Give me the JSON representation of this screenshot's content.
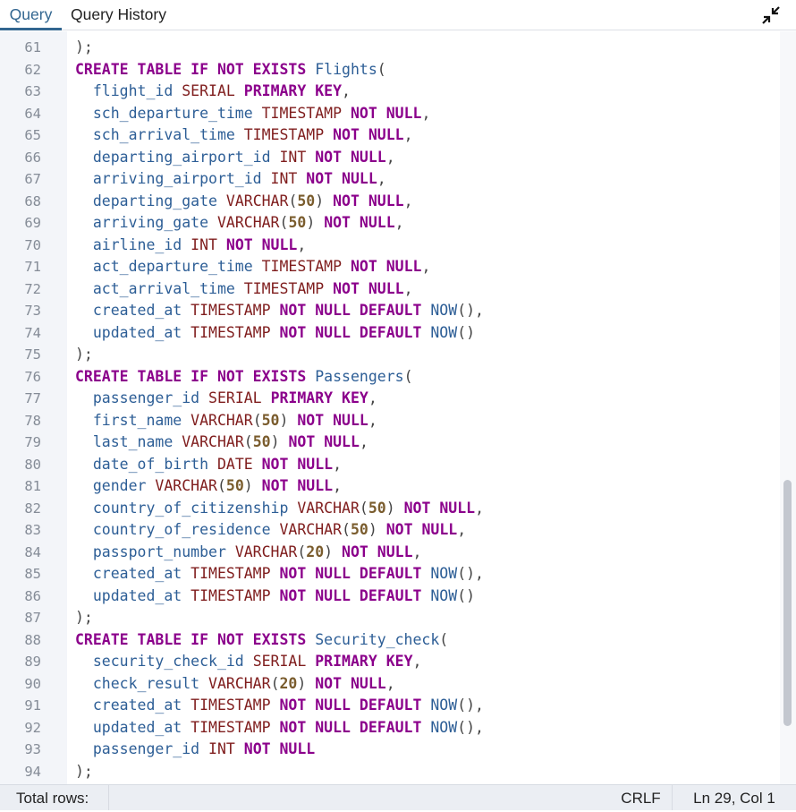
{
  "tabs": [
    {
      "label": "Query",
      "active": true
    },
    {
      "label": "Query History",
      "active": false
    }
  ],
  "icons": {
    "collapse": "collapse-arrows-icon"
  },
  "colors": {
    "accent": "#326690",
    "keyword": "#8b008b",
    "type": "#7f1d1d",
    "identifier": "#2d5e96",
    "number": "#7a5c2d"
  },
  "editor": {
    "lines": [
      {
        "n": "61",
        "tokens": [
          [
            "pu",
            ");"
          ]
        ]
      },
      {
        "n": "62",
        "tokens": [
          [
            "kw",
            "CREATE TABLE IF NOT EXISTS "
          ],
          [
            "id",
            "Flights"
          ],
          [
            "pu",
            "("
          ]
        ]
      },
      {
        "n": "63",
        "tokens": [
          [
            "id",
            "  flight_id "
          ],
          [
            "ty",
            "SERIAL "
          ],
          [
            "kw",
            "PRIMARY KEY"
          ],
          [
            "pu",
            ","
          ]
        ]
      },
      {
        "n": "64",
        "tokens": [
          [
            "id",
            "  sch_departure_time "
          ],
          [
            "ty",
            "TIMESTAMP "
          ],
          [
            "kw",
            "NOT NULL"
          ],
          [
            "pu",
            ","
          ]
        ]
      },
      {
        "n": "65",
        "tokens": [
          [
            "id",
            "  sch_arrival_time "
          ],
          [
            "ty",
            "TIMESTAMP "
          ],
          [
            "kw",
            "NOT NULL"
          ],
          [
            "pu",
            ","
          ]
        ]
      },
      {
        "n": "66",
        "tokens": [
          [
            "id",
            "  departing_airport_id "
          ],
          [
            "ty",
            "INT "
          ],
          [
            "kw",
            "NOT NULL"
          ],
          [
            "pu",
            ","
          ]
        ]
      },
      {
        "n": "67",
        "tokens": [
          [
            "id",
            "  arriving_airport_id "
          ],
          [
            "ty",
            "INT "
          ],
          [
            "kw",
            "NOT NULL"
          ],
          [
            "pu",
            ","
          ]
        ]
      },
      {
        "n": "68",
        "tokens": [
          [
            "id",
            "  departing_gate "
          ],
          [
            "ty",
            "VARCHAR"
          ],
          [
            "pu",
            "("
          ],
          [
            "nm",
            "50"
          ],
          [
            "pu",
            ") "
          ],
          [
            "kw",
            "NOT NULL"
          ],
          [
            "pu",
            ","
          ]
        ]
      },
      {
        "n": "69",
        "tokens": [
          [
            "id",
            "  arriving_gate "
          ],
          [
            "ty",
            "VARCHAR"
          ],
          [
            "pu",
            "("
          ],
          [
            "nm",
            "50"
          ],
          [
            "pu",
            ") "
          ],
          [
            "kw",
            "NOT NULL"
          ],
          [
            "pu",
            ","
          ]
        ]
      },
      {
        "n": "70",
        "tokens": [
          [
            "id",
            "  airline_id "
          ],
          [
            "ty",
            "INT "
          ],
          [
            "kw",
            "NOT NULL"
          ],
          [
            "pu",
            ","
          ]
        ]
      },
      {
        "n": "71",
        "tokens": [
          [
            "id",
            "  act_departure_time "
          ],
          [
            "ty",
            "TIMESTAMP "
          ],
          [
            "kw",
            "NOT NULL"
          ],
          [
            "pu",
            ","
          ]
        ]
      },
      {
        "n": "72",
        "tokens": [
          [
            "id",
            "  act_arrival_time "
          ],
          [
            "ty",
            "TIMESTAMP "
          ],
          [
            "kw",
            "NOT NULL"
          ],
          [
            "pu",
            ","
          ]
        ]
      },
      {
        "n": "73",
        "tokens": [
          [
            "id",
            "  created_at "
          ],
          [
            "ty",
            "TIMESTAMP "
          ],
          [
            "kw",
            "NOT NULL DEFAULT "
          ],
          [
            "id",
            "NOW"
          ],
          [
            "pu",
            "(),"
          ]
        ]
      },
      {
        "n": "74",
        "tokens": [
          [
            "id",
            "  updated_at "
          ],
          [
            "ty",
            "TIMESTAMP "
          ],
          [
            "kw",
            "NOT NULL DEFAULT "
          ],
          [
            "id",
            "NOW"
          ],
          [
            "pu",
            "()"
          ]
        ]
      },
      {
        "n": "75",
        "tokens": [
          [
            "pu",
            ");"
          ]
        ]
      },
      {
        "n": "76",
        "tokens": [
          [
            "kw",
            "CREATE TABLE IF NOT EXISTS "
          ],
          [
            "id",
            "Passengers"
          ],
          [
            "pu",
            "("
          ]
        ]
      },
      {
        "n": "77",
        "tokens": [
          [
            "id",
            "  passenger_id "
          ],
          [
            "ty",
            "SERIAL "
          ],
          [
            "kw",
            "PRIMARY KEY"
          ],
          [
            "pu",
            ","
          ]
        ]
      },
      {
        "n": "78",
        "tokens": [
          [
            "id",
            "  first_name "
          ],
          [
            "ty",
            "VARCHAR"
          ],
          [
            "pu",
            "("
          ],
          [
            "nm",
            "50"
          ],
          [
            "pu",
            ") "
          ],
          [
            "kw",
            "NOT NULL"
          ],
          [
            "pu",
            ","
          ]
        ]
      },
      {
        "n": "79",
        "tokens": [
          [
            "id",
            "  last_name "
          ],
          [
            "ty",
            "VARCHAR"
          ],
          [
            "pu",
            "("
          ],
          [
            "nm",
            "50"
          ],
          [
            "pu",
            ") "
          ],
          [
            "kw",
            "NOT NULL"
          ],
          [
            "pu",
            ","
          ]
        ]
      },
      {
        "n": "80",
        "tokens": [
          [
            "id",
            "  date_of_birth "
          ],
          [
            "ty",
            "DATE "
          ],
          [
            "kw",
            "NOT NULL"
          ],
          [
            "pu",
            ","
          ]
        ]
      },
      {
        "n": "81",
        "tokens": [
          [
            "id",
            "  gender "
          ],
          [
            "ty",
            "VARCHAR"
          ],
          [
            "pu",
            "("
          ],
          [
            "nm",
            "50"
          ],
          [
            "pu",
            ") "
          ],
          [
            "kw",
            "NOT NULL"
          ],
          [
            "pu",
            ","
          ]
        ]
      },
      {
        "n": "82",
        "tokens": [
          [
            "id",
            "  country_of_citizenship "
          ],
          [
            "ty",
            "VARCHAR"
          ],
          [
            "pu",
            "("
          ],
          [
            "nm",
            "50"
          ],
          [
            "pu",
            ") "
          ],
          [
            "kw",
            "NOT NULL"
          ],
          [
            "pu",
            ","
          ]
        ]
      },
      {
        "n": "83",
        "tokens": [
          [
            "id",
            "  country_of_residence "
          ],
          [
            "ty",
            "VARCHAR"
          ],
          [
            "pu",
            "("
          ],
          [
            "nm",
            "50"
          ],
          [
            "pu",
            ") "
          ],
          [
            "kw",
            "NOT NULL"
          ],
          [
            "pu",
            ","
          ]
        ]
      },
      {
        "n": "84",
        "tokens": [
          [
            "id",
            "  passport_number "
          ],
          [
            "ty",
            "VARCHAR"
          ],
          [
            "pu",
            "("
          ],
          [
            "nm",
            "20"
          ],
          [
            "pu",
            ") "
          ],
          [
            "kw",
            "NOT NULL"
          ],
          [
            "pu",
            ","
          ]
        ]
      },
      {
        "n": "85",
        "tokens": [
          [
            "id",
            "  created_at "
          ],
          [
            "ty",
            "TIMESTAMP "
          ],
          [
            "kw",
            "NOT NULL DEFAULT "
          ],
          [
            "id",
            "NOW"
          ],
          [
            "pu",
            "(),"
          ]
        ]
      },
      {
        "n": "86",
        "tokens": [
          [
            "id",
            "  updated_at "
          ],
          [
            "ty",
            "TIMESTAMP "
          ],
          [
            "kw",
            "NOT NULL DEFAULT "
          ],
          [
            "id",
            "NOW"
          ],
          [
            "pu",
            "()"
          ]
        ]
      },
      {
        "n": "87",
        "tokens": [
          [
            "pu",
            ");"
          ]
        ]
      },
      {
        "n": "88",
        "tokens": [
          [
            "kw",
            "CREATE TABLE IF NOT EXISTS "
          ],
          [
            "id",
            "Security_check"
          ],
          [
            "pu",
            "("
          ]
        ]
      },
      {
        "n": "89",
        "tokens": [
          [
            "id",
            "  security_check_id "
          ],
          [
            "ty",
            "SERIAL "
          ],
          [
            "kw",
            "PRIMARY KEY"
          ],
          [
            "pu",
            ","
          ]
        ]
      },
      {
        "n": "90",
        "tokens": [
          [
            "id",
            "  check_result "
          ],
          [
            "ty",
            "VARCHAR"
          ],
          [
            "pu",
            "("
          ],
          [
            "nm",
            "20"
          ],
          [
            "pu",
            ") "
          ],
          [
            "kw",
            "NOT NULL"
          ],
          [
            "pu",
            ","
          ]
        ]
      },
      {
        "n": "91",
        "tokens": [
          [
            "id",
            "  created_at "
          ],
          [
            "ty",
            "TIMESTAMP "
          ],
          [
            "kw",
            "NOT NULL DEFAULT "
          ],
          [
            "id",
            "NOW"
          ],
          [
            "pu",
            "(),"
          ]
        ]
      },
      {
        "n": "92",
        "tokens": [
          [
            "id",
            "  updated_at "
          ],
          [
            "ty",
            "TIMESTAMP "
          ],
          [
            "kw",
            "NOT NULL DEFAULT "
          ],
          [
            "id",
            "NOW"
          ],
          [
            "pu",
            "(),"
          ]
        ]
      },
      {
        "n": "93",
        "tokens": [
          [
            "id",
            "  passenger_id "
          ],
          [
            "ty",
            "INT "
          ],
          [
            "kw",
            "NOT NULL"
          ]
        ]
      },
      {
        "n": "94",
        "tokens": [
          [
            "pu",
            ");"
          ]
        ]
      }
    ]
  },
  "status": {
    "total_rows_label": "Total rows:",
    "line_ending": "CRLF",
    "cursor_position": "Ln 29, Col 1"
  }
}
